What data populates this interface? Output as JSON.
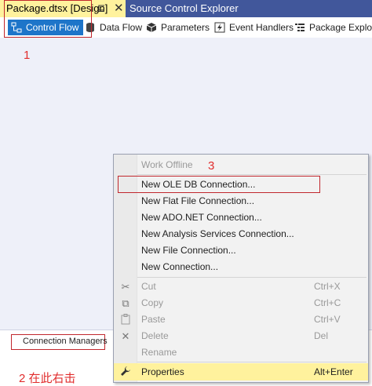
{
  "doc_tabs": {
    "active": "Package.dtsx [Design]",
    "pin_glyph": "⊑",
    "close_glyph": "✕",
    "inactive": "Source Control Explorer"
  },
  "designer_tabs": [
    {
      "label": "Control Flow",
      "icon": "control-flow-icon",
      "active": true
    },
    {
      "label": "Data Flow",
      "icon": "data-flow-icon"
    },
    {
      "label": "Parameters",
      "icon": "parameters-icon"
    },
    {
      "label": "Event Handlers",
      "icon": "event-handlers-icon"
    },
    {
      "label": "Package Explorer",
      "icon": "package-explorer-icon"
    }
  ],
  "annotations": {
    "one": "1",
    "two": "2 在此右击",
    "three": "3"
  },
  "connection_managers": {
    "tab_label": "Connection Managers"
  },
  "context_menu": {
    "items": [
      {
        "label": "Work Offline",
        "disabled": true
      },
      {
        "label": "New OLE DB Connection..."
      },
      {
        "label": "New Flat File Connection..."
      },
      {
        "label": "New ADO.NET Connection..."
      },
      {
        "label": "New Analysis Services Connection..."
      },
      {
        "label": "New File Connection..."
      },
      {
        "label": "New Connection..."
      },
      {
        "label": "Cut",
        "shortcut": "Ctrl+X",
        "icon": "cut-icon",
        "disabled": true
      },
      {
        "label": "Copy",
        "shortcut": "Ctrl+C",
        "icon": "copy-icon",
        "disabled": true
      },
      {
        "label": "Paste",
        "shortcut": "Ctrl+V",
        "icon": "paste-icon",
        "disabled": true
      },
      {
        "label": "Delete",
        "shortcut": "Del",
        "icon": "delete-icon",
        "disabled": true
      },
      {
        "label": "Rename",
        "disabled": true
      },
      {
        "label": "Properties",
        "shortcut": "Alt+Enter",
        "icon": "wrench-icon",
        "highlighted": true
      }
    ]
  },
  "colors": {
    "accent": "#1e75c9",
    "annotation_red": "#e12d2d",
    "tab_yellow": "#fff29d",
    "inactive_tab": "#41579b"
  }
}
